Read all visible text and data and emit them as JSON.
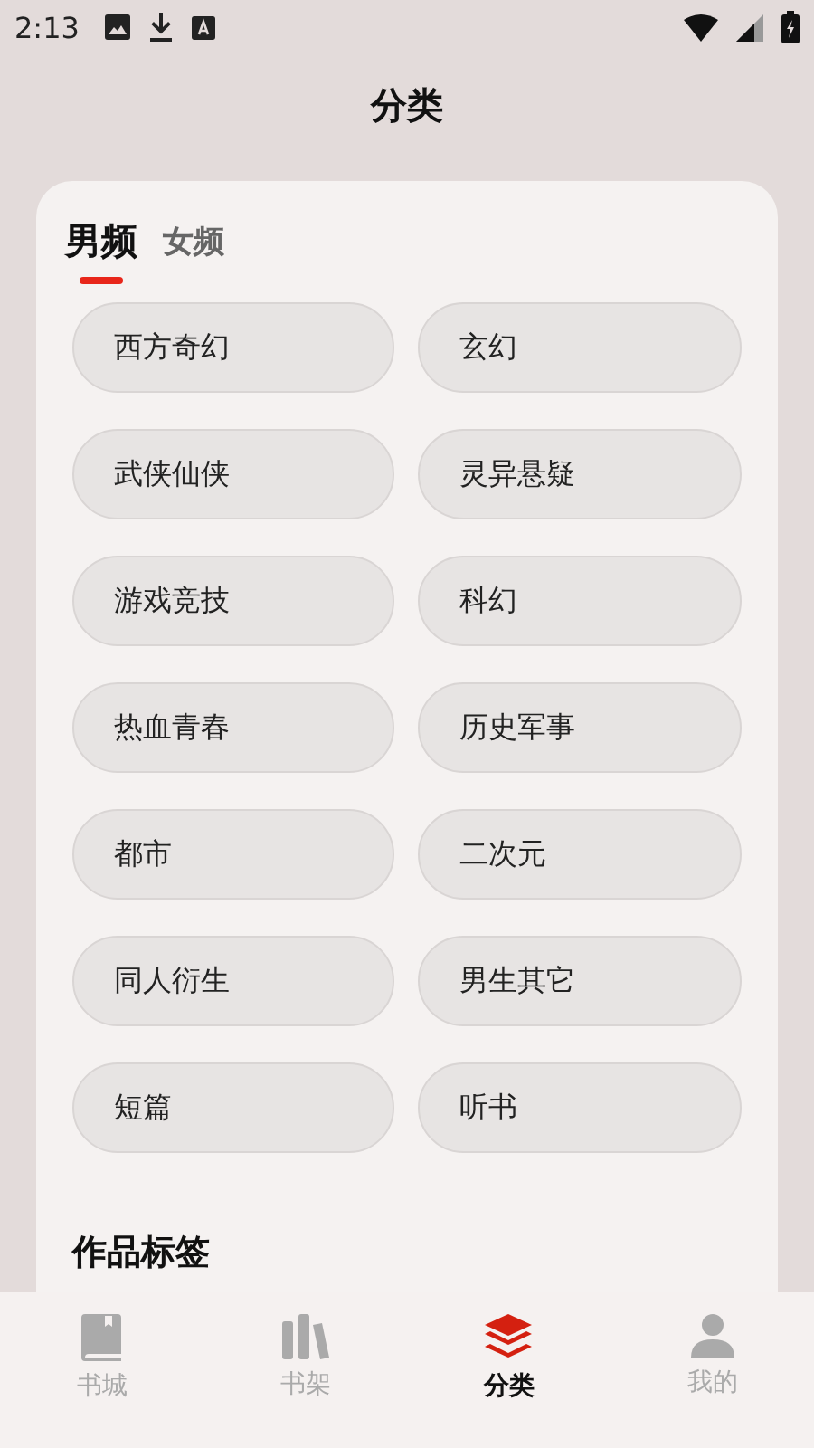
{
  "status_bar": {
    "time": "2:13"
  },
  "title": "分类",
  "tabs": [
    {
      "label": "男频",
      "selected": true
    },
    {
      "label": "女频",
      "selected": false
    }
  ],
  "categories": [
    "西方奇幻",
    "玄幻",
    "武侠仙侠",
    "灵异悬疑",
    "游戏竞技",
    "科幻",
    "热血青春",
    "历史军事",
    "都市",
    "二次元",
    "同人衍生",
    "男生其它",
    "短篇",
    "听书"
  ],
  "section_heading": "作品标签",
  "bottom_nav": [
    {
      "label": "书城",
      "kind": "book",
      "selected": false
    },
    {
      "label": "书架",
      "kind": "shelf",
      "selected": false
    },
    {
      "label": "分类",
      "kind": "layers",
      "selected": true
    },
    {
      "label": "我的",
      "kind": "person",
      "selected": false
    }
  ]
}
